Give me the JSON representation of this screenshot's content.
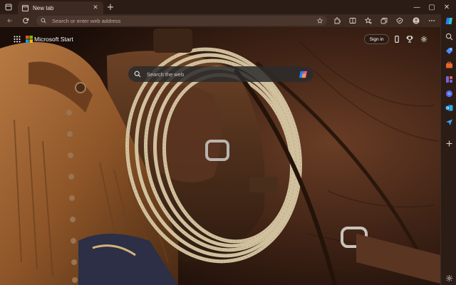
{
  "tabbar": {
    "tab_title": "New tab",
    "tab_close_glyph": "✕",
    "new_tab_glyph": "+",
    "window_min_glyph": "—",
    "window_max_glyph": "▢",
    "window_close_glyph": "✕"
  },
  "address_bar": {
    "placeholder": "Search or enter web address"
  },
  "newtab_page": {
    "brand": "Microsoft Start",
    "signin_label": "Sign in",
    "search_placeholder": "Search the web"
  },
  "toolbar_icons": [
    "back-icon",
    "refresh-icon",
    "info-icon",
    "favorite-star-icon",
    "extensions-icon",
    "reading-view-icon",
    "favorites-icon",
    "collections-icon",
    "browser-essentials-icon",
    "profile-avatar-icon",
    "more-menu-icon"
  ],
  "sidebar_icons": [
    "copilot-icon",
    "search-icon",
    "shopping-icon",
    "tools-icon",
    "games-icon",
    "outlook-icon",
    "drop-icon",
    "add-icon",
    "settings-icon"
  ],
  "colors": {
    "titlebar": "#2b1d16",
    "toolbar": "#3d2a21",
    "omnibox": "#4a362d",
    "searchbox": "#2c2c2c"
  }
}
